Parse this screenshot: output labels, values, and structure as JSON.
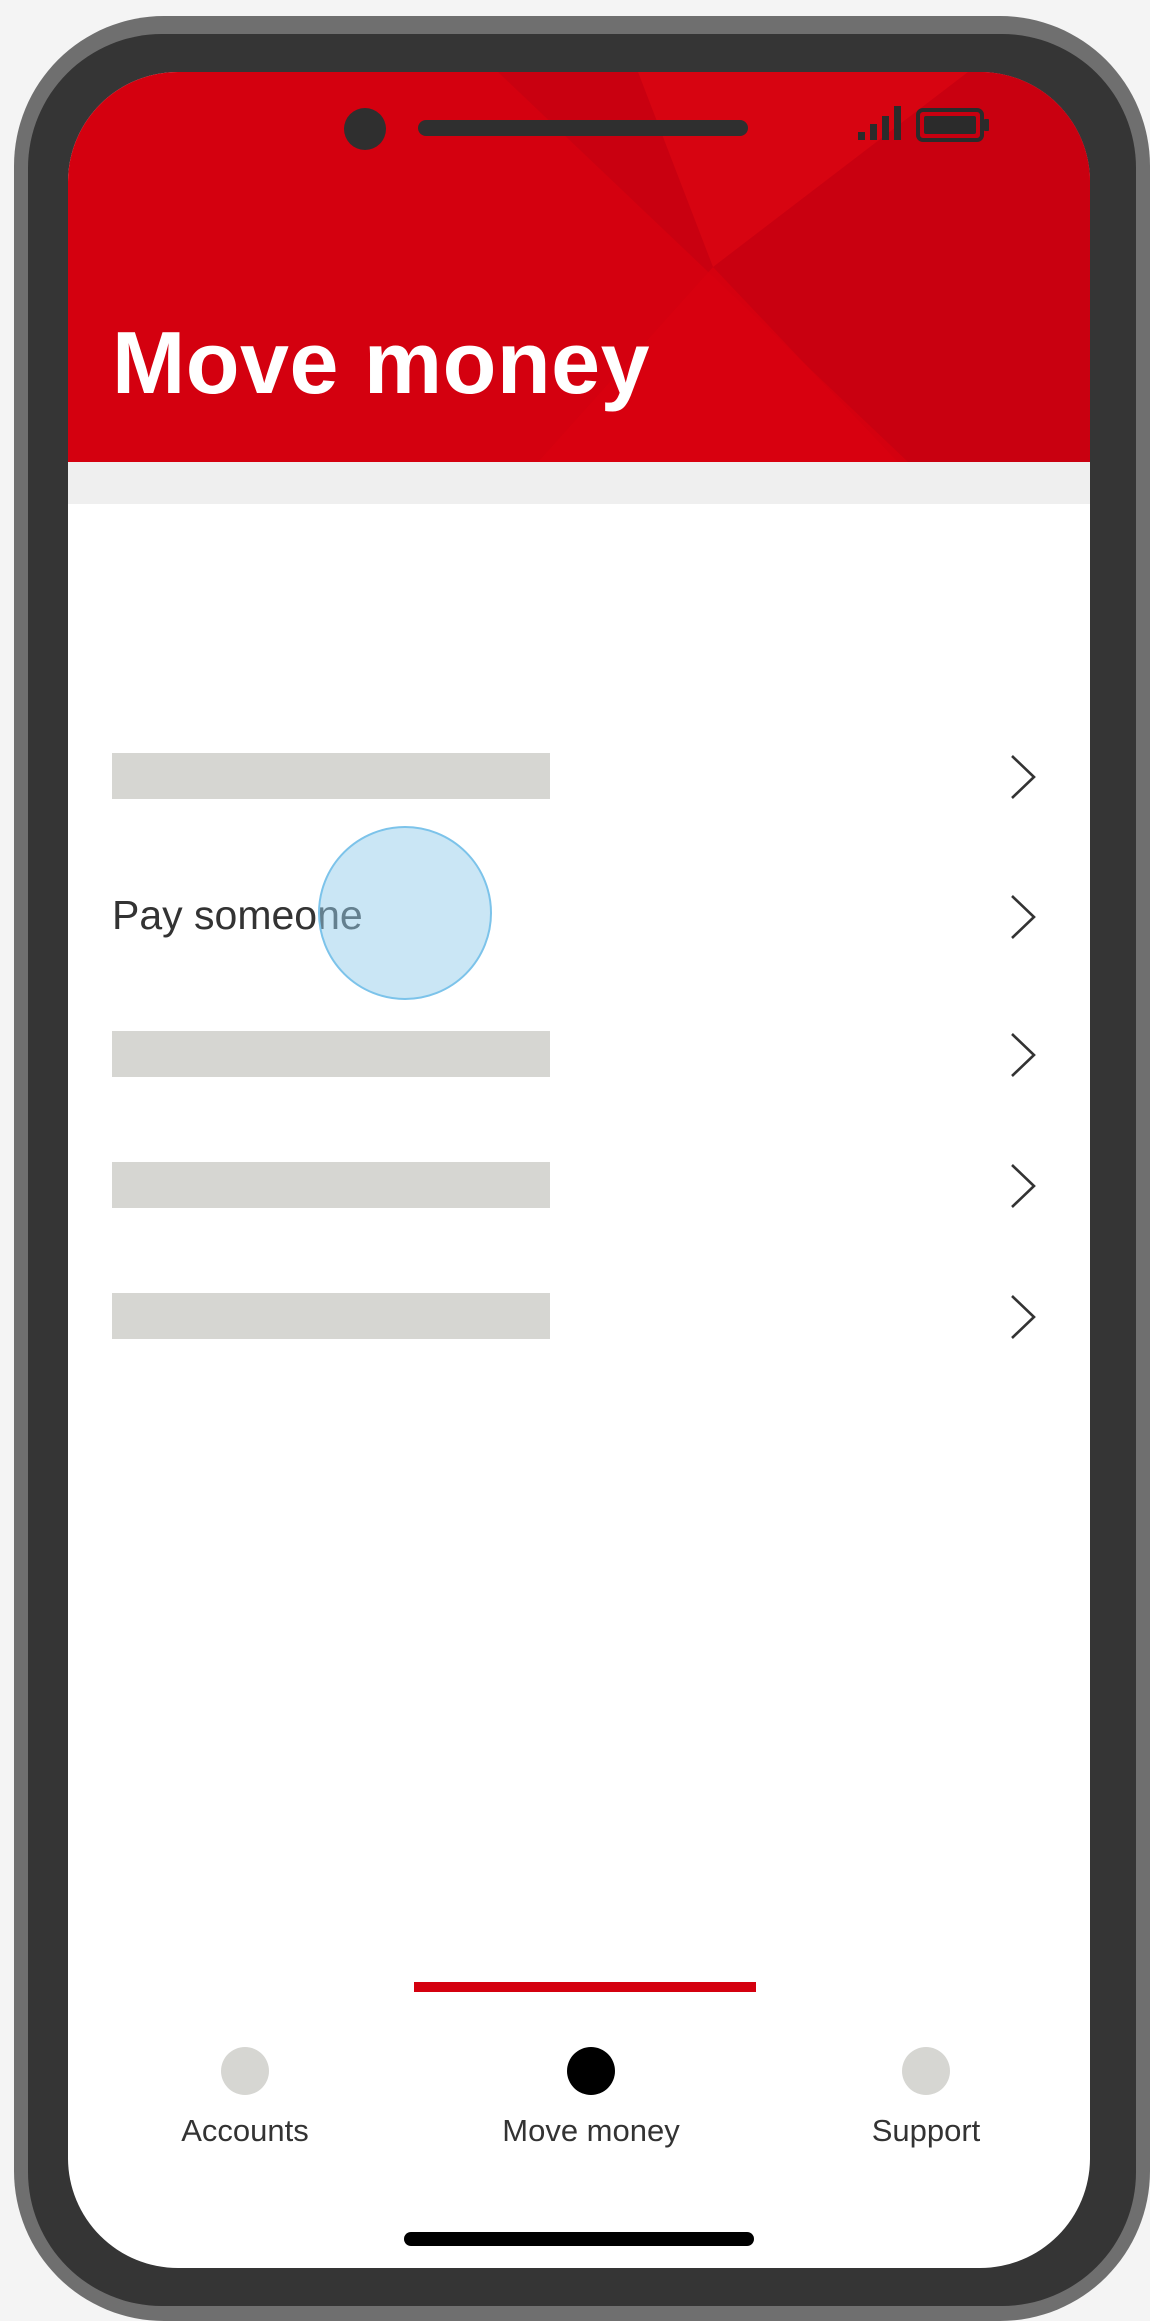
{
  "header": {
    "title": "Move money"
  },
  "list": {
    "items": [
      {
        "label": "",
        "placeholder": true
      },
      {
        "label": "Pay someone",
        "placeholder": false
      },
      {
        "label": "",
        "placeholder": true
      },
      {
        "label": "",
        "placeholder": true
      },
      {
        "label": "",
        "placeholder": true
      }
    ]
  },
  "tabs": [
    {
      "label": "Accounts",
      "active": false
    },
    {
      "label": "Move money",
      "active": true
    },
    {
      "label": "Support",
      "active": false
    }
  ],
  "icons": {
    "row_chevron": "chevron-right-icon",
    "signal": "signal-icon",
    "battery": "battery-icon"
  },
  "colors": {
    "brand_red": "#d4000f",
    "placeholder": "#d6d6d2",
    "touch_indicator": "#7cc3ea"
  }
}
